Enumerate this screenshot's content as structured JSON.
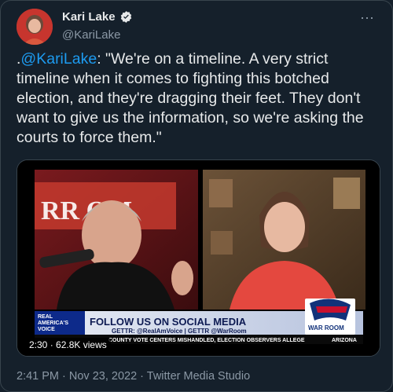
{
  "author": {
    "display_name": "Kari Lake",
    "handle": "@KariLake",
    "verified": true,
    "avatar_icon": "profile-photo-icon"
  },
  "more_icon": "⋯",
  "tweet": {
    "prefix": ".",
    "mention": "@KariLake",
    "body": ": \"We're on a timeline. A very strict timeline when it comes to fighting this botched election, and they're dragging their feet. They don't want to give us the information, so we're asking the courts to force them.\""
  },
  "video": {
    "duration": "2:30",
    "views": "62.8K views",
    "banner_logo_top": "REAL",
    "banner_logo_mid": "AMERICA'S",
    "banner_logo_bot": "VOICE",
    "banner_headline": "FOLLOW US ON SOCIAL MEDIA",
    "banner_handles": "GETTR: @RealAmVoice | GETTR @WarRoom",
    "ticker": "COUNTY VOTE CENTERS MISHANDLED, ELECTION OBSERVERS ALLEGE",
    "ticker_location": "ARIZONA",
    "war_room_label": "WAR ROOM",
    "backdrop_text": "RR  OM"
  },
  "meta": {
    "time": "2:41 PM",
    "separator": " · ",
    "date": "Nov 23, 2022",
    "source": "Twitter Media Studio"
  },
  "colors": {
    "background": "#15202b",
    "link": "#1d9bf0",
    "muted": "#8b98a5"
  }
}
